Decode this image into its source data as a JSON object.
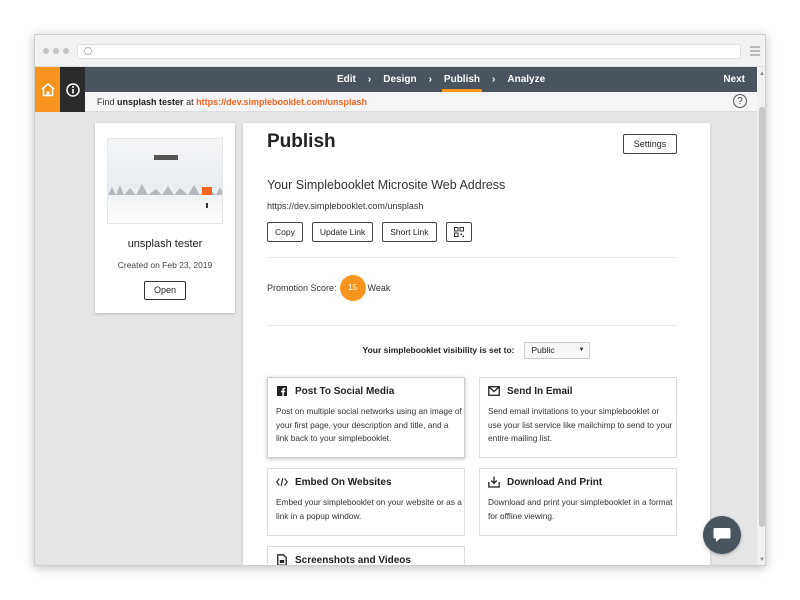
{
  "nav": {
    "steps": [
      "Edit",
      "Design",
      "Publish",
      "Analyze"
    ],
    "active_step": "Publish",
    "separator": "›",
    "next_label": "Next"
  },
  "findbar": {
    "prefix": "Find",
    "name": "unsplash tester",
    "middle": "at",
    "link": "https://dev.simplebooklet.com/unsplash",
    "help": "?"
  },
  "booklet": {
    "title": "unsplash tester",
    "created": "Created on Feb 23, 2019",
    "open_label": "Open"
  },
  "publish": {
    "title": "Publish",
    "settings_label": "Settings",
    "section_title": "Your Simplebooklet Microsite Web Address",
    "url": "https://dev.simplebooklet.com/unsplash",
    "buttons": [
      "Copy",
      "Update Link",
      "Short Link"
    ],
    "promotion_label": "Promotion Score:",
    "promotion_score": "15",
    "promotion_rating": "Weak",
    "visibility_label": "Your simplebooklet visibility is set to:",
    "visibility_value": "Public"
  },
  "options": [
    {
      "title": "Post To Social Media",
      "icon": "facebook-icon",
      "desc": "Post on multiple social networks using an image of your first page, your description and title, and a link back to your simplebooklet."
    },
    {
      "title": "Send In Email",
      "icon": "email-icon",
      "desc": "Send email invitations to your simplebooklet or use your list service like mailchimp to send to your entire mailing list."
    },
    {
      "title": "Embed On Websites",
      "icon": "code-icon",
      "desc": "Embed your simplebooklet on your website or as a link in a popup window."
    },
    {
      "title": "Download And Print",
      "icon": "download-icon",
      "desc": "Download and print your simplebooklet in a format for offline viewing."
    },
    {
      "title": "Screenshots and Videos",
      "icon": "document-icon",
      "desc": ""
    }
  ],
  "colors": {
    "accent": "#f7941d",
    "nav_bg": "#4a545e",
    "link": "#f26522"
  }
}
